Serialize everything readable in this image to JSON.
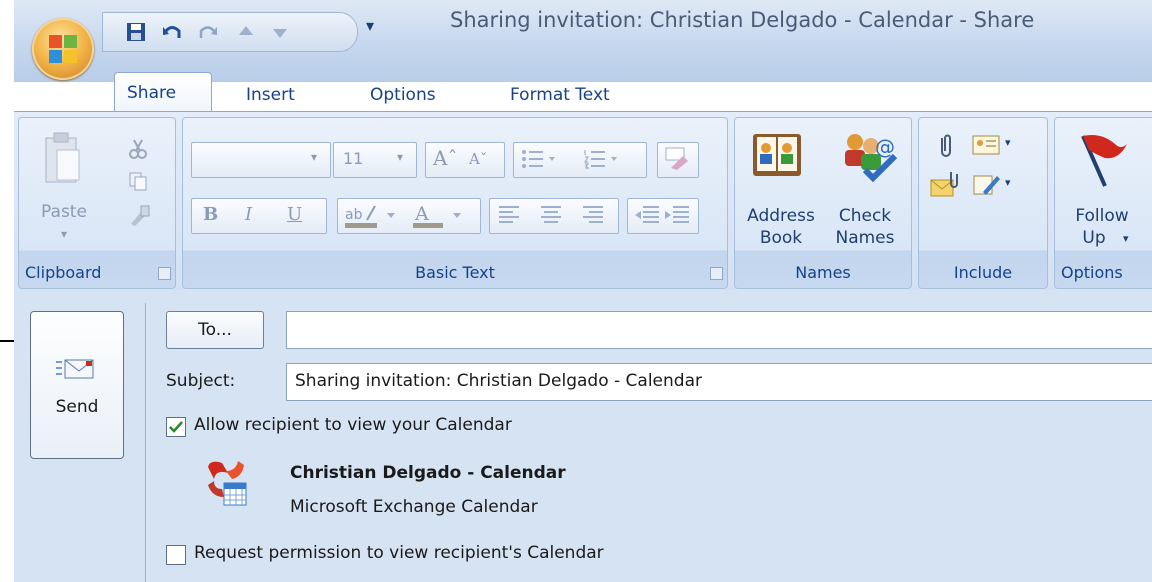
{
  "window": {
    "title": "Sharing invitation: Christian Delgado - Calendar - Share"
  },
  "tabs": [
    {
      "label": "Share"
    },
    {
      "label": "Insert"
    },
    {
      "label": "Options"
    },
    {
      "label": "Format Text"
    }
  ],
  "ribbon": {
    "clipboard": {
      "paste_label": "Paste",
      "group_label": "Clipboard"
    },
    "basic_text": {
      "font_size": "11",
      "group_label": "Basic Text",
      "bold": "B",
      "italic": "I",
      "underline": "U"
    },
    "names": {
      "address_book_line1": "Address",
      "address_book_line2": "Book",
      "check_names_line1": "Check",
      "check_names_line2": "Names",
      "group_label": "Names"
    },
    "include": {
      "group_label": "Include"
    },
    "options": {
      "follow_up_line1": "Follow",
      "follow_up_line2": "Up",
      "group_label": "Options"
    }
  },
  "form": {
    "send_label": "Send",
    "to_label": "To...",
    "to_value": "",
    "subject_label": "Subject:",
    "subject_value": "Sharing invitation: Christian Delgado - Calendar",
    "allow_label": "Allow recipient to view your Calendar",
    "allow_checked": true,
    "calendar_name": "Christian Delgado - Calendar",
    "calendar_type": "Microsoft Exchange Calendar",
    "request_label": "Request permission to view recipient's Calendar",
    "request_checked": false
  },
  "icons": [
    "office-orb-icon",
    "save-icon",
    "undo-icon",
    "redo-icon",
    "up-arrow-icon",
    "down-arrow-icon",
    "paste-icon",
    "cut-icon",
    "copy-icon",
    "format-painter-icon",
    "address-book-icon",
    "check-names-icon",
    "attach-file-icon",
    "attach-item-icon",
    "business-card-icon",
    "signature-icon",
    "follow-up-flag-icon",
    "send-envelope-icon",
    "exchange-calendar-icon"
  ],
  "colors": {
    "tab_text": "#15428b",
    "ribbon_bg": "#d3e1f3",
    "form_bg": "#d6e3f3",
    "orb": "#f4b64a"
  }
}
